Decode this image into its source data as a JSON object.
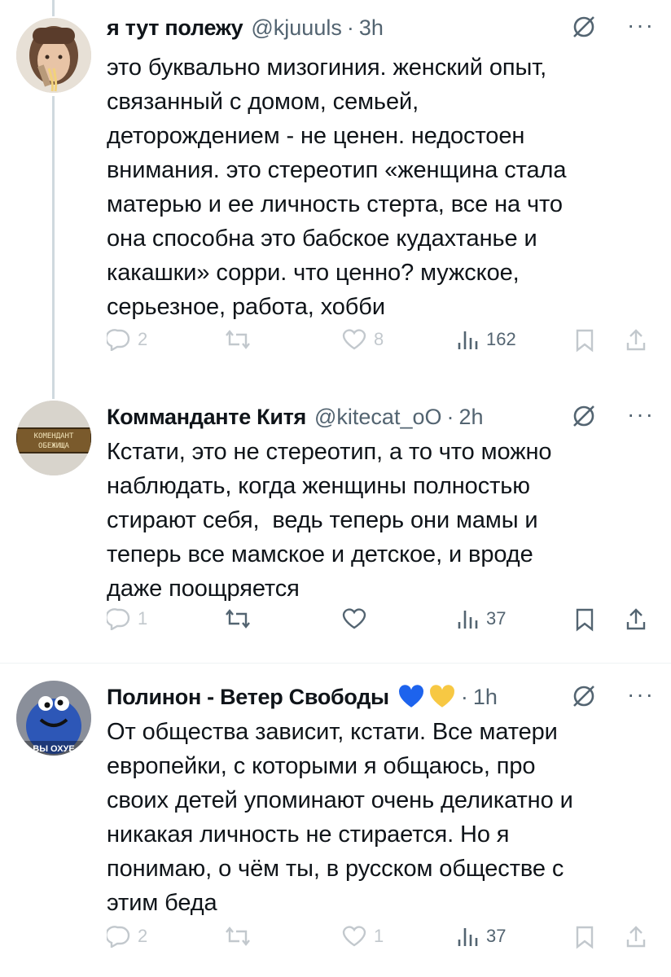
{
  "tweets": [
    {
      "name": "я тут полежу",
      "handle": "@kjuuuls",
      "time": "3h",
      "text": "это буквально мизогиния. женский опыт,\nсвязанный с домом, семьей,\nдеторождением - не ценен. недостоен\nвнимания. это стереотип «женщина стала\nматерью и ее личность стерта, все на что\nона способна это бабское кудахтанье и\nкакашки» сорри. что ценно? мужское,\nсерьезное, работа, хобби",
      "replies": "2",
      "retweets": "",
      "likes": "8",
      "views": "162",
      "avatar_icon": "avatar-girl-eating-noodles",
      "actions_faded": true
    },
    {
      "name": "Коммanданте Китя",
      "handle": "@kitecat_oO",
      "time": "2h",
      "text": "Кстати, это не стереотип, а то что можно\nнаблюдать, когда женщины полностью\nстирают себя,  ведь теперь они мамы и\nтеперь все мамское и детское, и вроде\nдаже поощряется",
      "replies": "1",
      "retweets": "",
      "likes": "",
      "views": "37",
      "avatar_icon": "avatar-sign",
      "avatar_sign_line1": "КОМЕНДАНТ",
      "avatar_sign_line2": "ОБЕЖИЩА",
      "actions_faded": false
    },
    {
      "name": "Полинон - Ветер Свободы",
      "emoji": "💙💛",
      "handle": "",
      "time": "1h",
      "text": "От общества зависит, кстати. Все матери\nевропейки, с которыми я общаюсь, про\nсвоих детей упоминают очень деликатно и\nникакая личность не стирается. Но я\nпонимаю, о чём ты, в русском обществе с\nэтим беда",
      "replies": "2",
      "retweets": "",
      "likes": "1",
      "views": "37",
      "avatar_icon": "avatar-cookie-monster",
      "avatar_caption": "ВЫ ОХУЕ",
      "actions_faded": true
    }
  ],
  "dot": "·",
  "more": "···",
  "colors": {
    "text": "#0f1419",
    "muted": "#536471",
    "line": "#cfd9de",
    "heart_blue": "#1d63ed",
    "heart_yellow": "#f7c843"
  }
}
